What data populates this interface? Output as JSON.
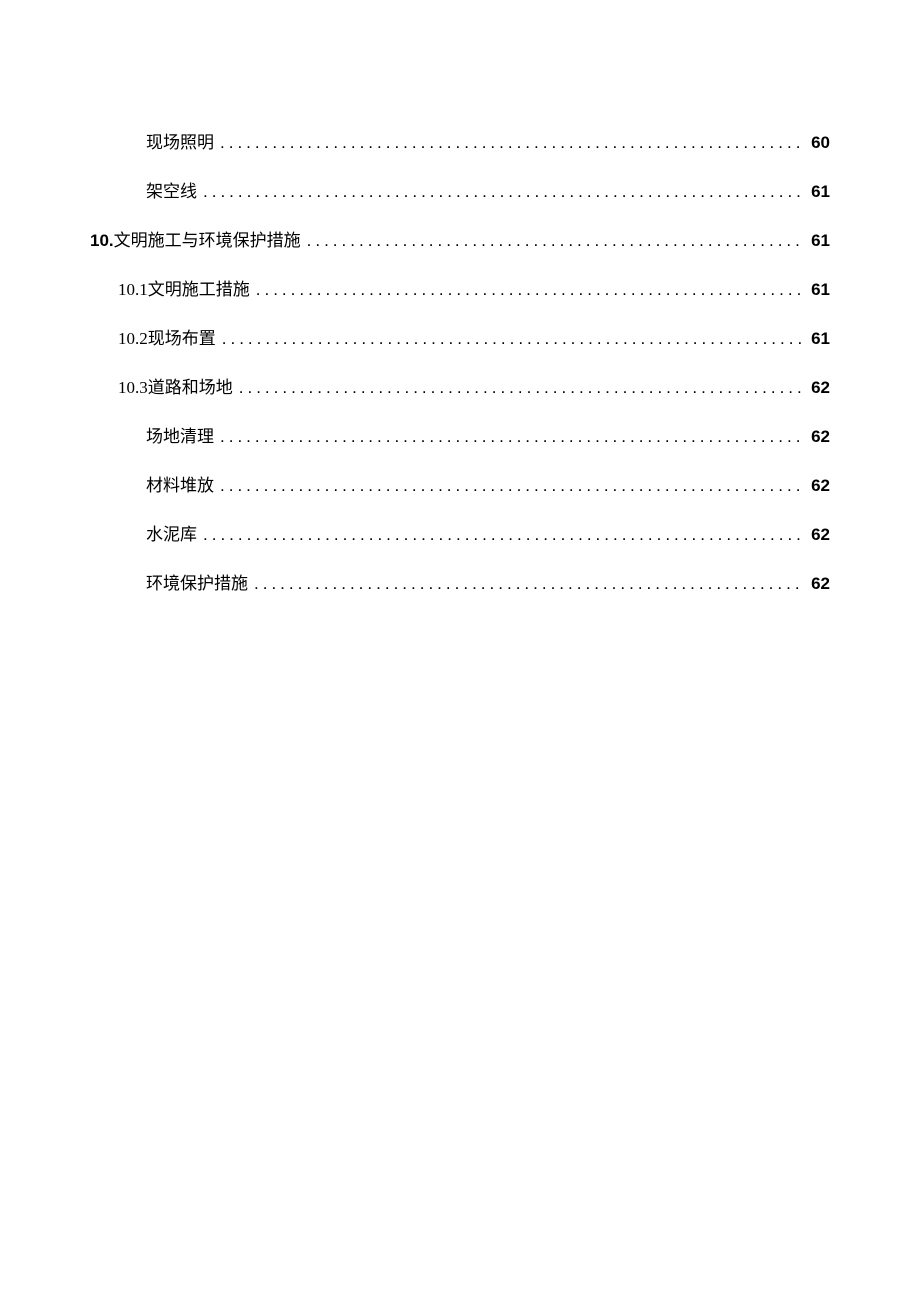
{
  "toc": {
    "entries": [
      {
        "level": 3,
        "prefix": "",
        "label": "现场照明",
        "page": "60",
        "boldPrefix": false
      },
      {
        "level": 3,
        "prefix": "",
        "label": "架空线",
        "page": "61",
        "boldPrefix": false
      },
      {
        "level": 1,
        "prefix": "10.",
        "label": "文明施工与环境保护措施",
        "page": "61",
        "boldPrefix": true
      },
      {
        "level": 2,
        "prefix": "10.1",
        "label": "文明施工措施",
        "page": "61",
        "boldPrefix": false
      },
      {
        "level": 2,
        "prefix": "10.2",
        "label": "现场布置",
        "page": "61",
        "boldPrefix": false
      },
      {
        "level": 2,
        "prefix": "10.3",
        "label": "道路和场地",
        "page": "62",
        "boldPrefix": false
      },
      {
        "level": 3,
        "prefix": "",
        "label": "场地清理",
        "page": "62",
        "boldPrefix": false
      },
      {
        "level": 3,
        "prefix": "",
        "label": "材料堆放",
        "page": "62",
        "boldPrefix": false
      },
      {
        "level": 3,
        "prefix": "",
        "label": "水泥库",
        "page": "62",
        "boldPrefix": false
      },
      {
        "level": 3,
        "prefix": "",
        "label": "环境保护措施",
        "page": "62",
        "boldPrefix": false
      }
    ]
  }
}
